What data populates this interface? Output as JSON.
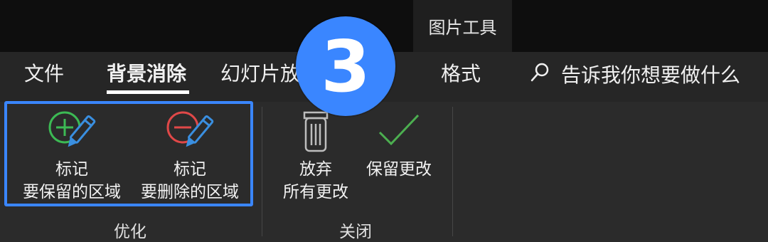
{
  "context_tab": {
    "label": "图片工具"
  },
  "tabs": [
    {
      "label": "文件"
    },
    {
      "label": "背景消除"
    },
    {
      "label": "幻灯片放"
    },
    {
      "label": "格式"
    }
  ],
  "tell_me": {
    "label": "告诉我你想要做什么"
  },
  "step_badge": {
    "label": "3"
  },
  "groups": {
    "optimize": {
      "label": "优化",
      "mark_keep": {
        "line1": "标记",
        "line2": "要保留的区域"
      },
      "mark_remove": {
        "line1": "标记",
        "line2": "要删除的区域"
      }
    },
    "close": {
      "label": "关闭",
      "discard": {
        "line1": "放弃",
        "line2": "所有更改"
      },
      "keep_changes": {
        "line1": "保留更改"
      }
    }
  },
  "colors": {
    "highlight": "#3a86ff",
    "keep_icon": "#3cba54",
    "remove_icon": "#e04848",
    "pencil": "#3a8fe0",
    "check": "#4caf50"
  }
}
